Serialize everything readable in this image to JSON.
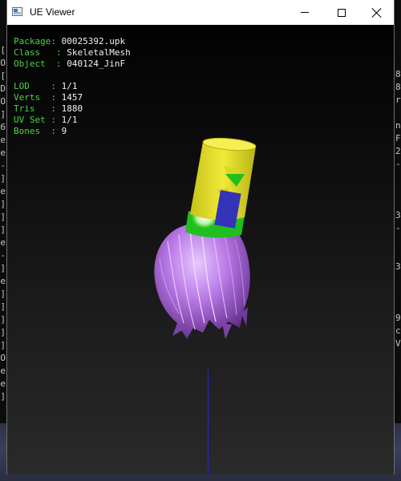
{
  "window": {
    "title": "UE Viewer"
  },
  "info_block_1": [
    {
      "label": "Package: ",
      "value": "00025392.upk"
    },
    {
      "label": "Class   : ",
      "value": "SkeletalMesh"
    },
    {
      "label": "Object  : ",
      "value": "040124_JinF"
    }
  ],
  "info_block_2": [
    {
      "label": "LOD    : ",
      "value": "1/1"
    },
    {
      "label": "Verts  : ",
      "value": "1457"
    },
    {
      "label": "Tris   : ",
      "value": "1880"
    },
    {
      "label": "UV Set : ",
      "value": "1/1"
    },
    {
      "label": "Bones  : ",
      "value": "9"
    }
  ],
  "background_console": {
    "left_chars": [
      "[",
      "O",
      "[",
      "D",
      "O",
      "]",
      "6",
      "e",
      "e",
      "-",
      "]",
      "e",
      "]",
      "]",
      "]",
      "e",
      "-",
      "]",
      "e",
      "]",
      "]",
      "]",
      "]",
      "]",
      "O",
      "e",
      "e",
      "]"
    ],
    "right_chars": [
      "8",
      "8",
      "r",
      "",
      "n",
      "F",
      "2",
      "-",
      "",
      "",
      "",
      "3",
      "-",
      "",
      "",
      "3",
      "",
      "",
      "",
      "9",
      "c",
      "V"
    ]
  },
  "colors": {
    "label_green": "#49d447",
    "value_white": "#f0f0f0",
    "hair_purple": "#b877e6",
    "cylinder_yellow": "#e6e12a",
    "band_green": "#1fbf1f",
    "marker_blue": "#3434b8",
    "axis_blue": "#2828c8"
  },
  "icons": [
    "app-window-icon",
    "minimize-icon",
    "maximize-icon",
    "close-icon"
  ]
}
